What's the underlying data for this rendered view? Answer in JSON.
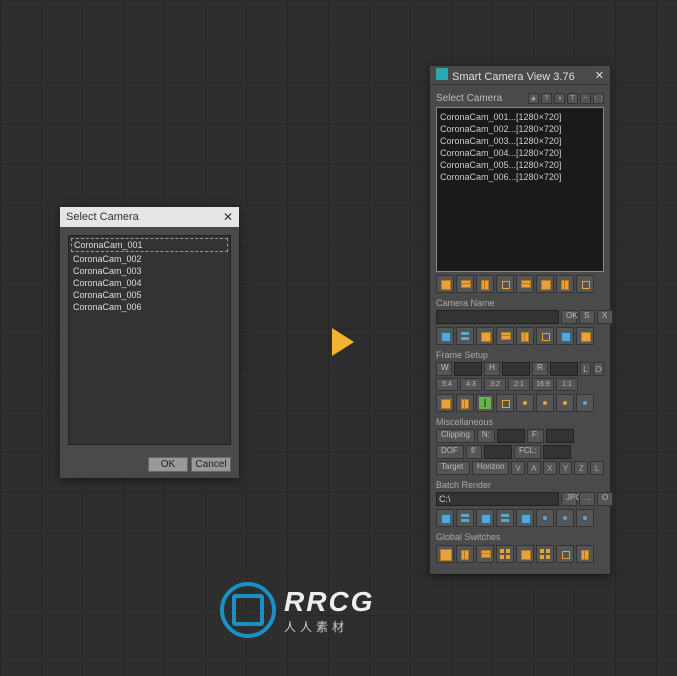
{
  "left_dialog": {
    "title": "Select Camera",
    "items": [
      "CoronaCam_001",
      "CoronaCam_002",
      "CoronaCam_003",
      "CoronaCam_004",
      "CoronaCam_005",
      "CoronaCam_006"
    ],
    "ok": "OK",
    "cancel": "Cancel"
  },
  "panel": {
    "title": "Smart Camera View 3.76",
    "select_camera_label": "Select Camera",
    "header_icons": [
      "★",
      "?",
      "◑",
      "T",
      "−",
      "⋮⋮"
    ],
    "cameras": [
      "CoronaCam_001...[1280×720]",
      "CoronaCam_002...[1280×720]",
      "CoronaCam_003...[1280×720]",
      "CoronaCam_004...[1280×720]",
      "CoronaCam_005...[1280×720]",
      "CoronaCam_006...[1280×720]"
    ],
    "camera_name_label": "Camera Name",
    "ok_btn": "OK",
    "s_btn": "S",
    "x_btn": "X",
    "frame_setup_label": "Frame Setup",
    "fs": {
      "w": "W",
      "h": "H",
      "r": "R",
      "l": "L",
      "o": "O"
    },
    "ratios": [
      "5:4",
      "4:3",
      "3:2",
      "2:1",
      "16:9",
      "1:1"
    ],
    "misc_label": "Miscellaneous",
    "misc": {
      "clipping": "Clipping",
      "n": "N:",
      "f": "F:",
      "dof": "DOF",
      "ff": "f/",
      "fcl": "FCL:",
      "target": "Target",
      "horizon": "Horizon",
      "v": "V",
      "a": "A",
      "x": "X",
      "y": "Y",
      "z": "Z",
      "l": "L"
    },
    "batch_label": "Batch Render",
    "batch": {
      "path": "C:\\",
      "jpg": "JPG",
      "dots": "...",
      "o": "O"
    },
    "global_label": "Global Switches"
  },
  "watermark": {
    "big": "RRCG",
    "sm": "人人素材"
  }
}
